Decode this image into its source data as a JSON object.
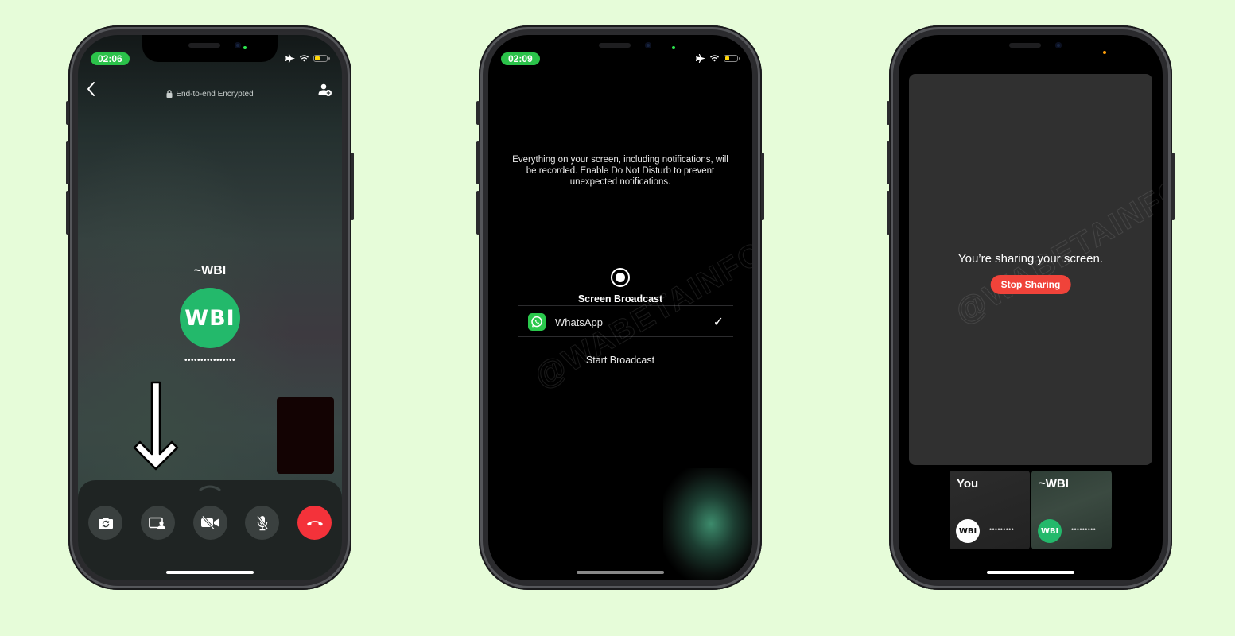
{
  "background_color": "#e6fcd9",
  "phones": [
    {
      "status": {
        "time": "02:06",
        "icons": [
          "airplane-icon",
          "wifi-icon",
          "battery-icon"
        ]
      },
      "header": {
        "back_icon": "chevron-left-icon",
        "encryption_label": "End-to-end Encrypted",
        "add_participant_icon": "add-user-icon"
      },
      "contact": {
        "name": "~WBI",
        "avatar_text": "WBI",
        "status_dots": "••••••••••••••••"
      },
      "controls": [
        {
          "name": "flip-camera",
          "icon": "camera-flip-icon"
        },
        {
          "name": "share-screen",
          "icon": "screen-share-icon"
        },
        {
          "name": "video-off",
          "icon": "video-off-icon"
        },
        {
          "name": "mute",
          "icon": "mic-off-icon"
        },
        {
          "name": "end-call",
          "icon": "phone-hangup-icon"
        }
      ],
      "annotation": "down-arrow-icon"
    },
    {
      "status": {
        "time": "02:09",
        "icons": [
          "airplane-icon",
          "wifi-icon",
          "battery-icon"
        ]
      },
      "notice": "Everything on your screen, including notifications, will be recorded. Enable Do Not Disturb to prevent unexpected notifications.",
      "broadcast_title": "Screen Broadcast",
      "app": {
        "name": "WhatsApp",
        "selected": true
      },
      "start_label": "Start Broadcast",
      "watermark": "@WABETAINFO"
    },
    {
      "sharing_text": "You’re sharing your screen.",
      "stop_label": "Stop Sharing",
      "watermark": "@WABETAINFO",
      "tiles": [
        {
          "name": "You",
          "avatar_text": "WBI",
          "dots": "•••••••••"
        },
        {
          "name": "~WBI",
          "avatar_text": "WBI",
          "dots": "•••••••••"
        }
      ]
    }
  ],
  "colors": {
    "whatsapp_green": "#23b96b",
    "status_pill_green": "#2bc24a",
    "end_call_red": "#f4323a",
    "stop_red": "#f0433a"
  }
}
